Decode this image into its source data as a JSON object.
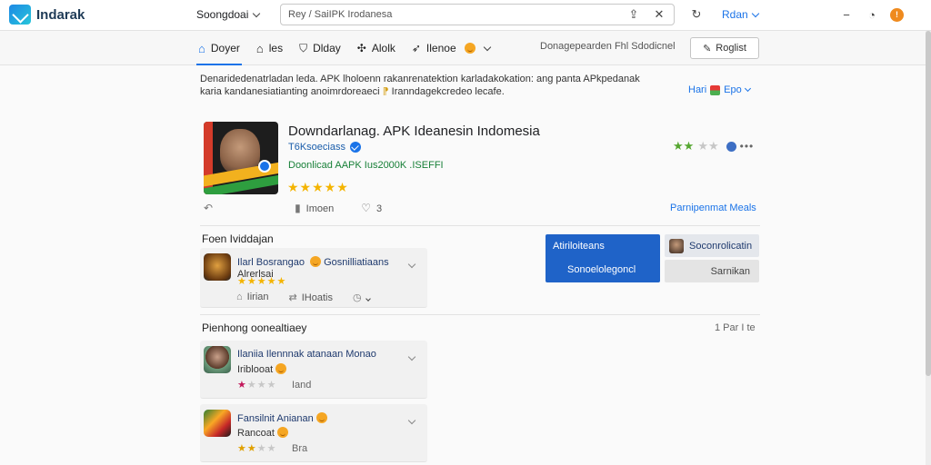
{
  "topbar": {
    "logo_text": "Indarak",
    "category_select": "Soongdoai",
    "search_placeholder": "Rey / SaiIPK  Irodanesa",
    "user_menu": "Rdan"
  },
  "nav": {
    "tabs": [
      {
        "label": "Doyer"
      },
      {
        "label": "les"
      },
      {
        "label": "Dlday"
      },
      {
        "label": "Alolk"
      },
      {
        "label": "Ilenoe"
      }
    ],
    "status_text": "Donagepearden  Fhl  Sdodicnel",
    "register_label": "Roglist"
  },
  "description": {
    "line1": "Denaridedenatrladan leda. APK lholoenn rakanrenatektion karladakokation:  ang  panta APkpedanak",
    "line2": "karia kandanesiatianting anoimrdoreaeci",
    "line2_end": "Iranndagekcredeo lecafe.",
    "lang_label": "Hari",
    "lang_value": "Epo"
  },
  "app": {
    "title": "Downdarlanag. APK Ideanesin Indomesia",
    "developer": "T6Ksoeciass",
    "download_text": "Doonlicad AAPK Ius2000K .ISEFFI",
    "stars": "★★★★★",
    "side_rating_on": "★★",
    "side_rating_off": "★★",
    "more": "•••",
    "action_share": "",
    "action_likes": "Imoen",
    "action_count": "3",
    "report_link": "Parnipenmat Meals"
  },
  "reviews_section": {
    "title": "Foen Ividdajan",
    "item": {
      "name": "Ilarl Bosrangao",
      "name_rest": "Gosnilliatiaans",
      "sub": "Alrerlsai",
      "stars": "★★★★★",
      "action1": "Iirian",
      "action2": "IHoatis"
    }
  },
  "promo": {
    "title": "Atiriloiteans",
    "subtitle": "Sonoelolegoncl",
    "btn1": "Soconrolicatin",
    "btn2": "Sarnikan"
  },
  "popular_section": {
    "title": "Pienhong oonealtiaey",
    "page_count": "1 Par I te",
    "items": [
      {
        "name": "Ilaniia Ilennnak atanaan Monao",
        "sub": "Iriblooat",
        "stars_on": "★",
        "stars_off": "★★★",
        "meta": "Iand"
      },
      {
        "name": "Fansilnit Anianan",
        "sub": "Rancoat",
        "stars_on": "★★",
        "stars_off": "★★",
        "meta": "Bra"
      }
    ]
  },
  "colors": {
    "accent": "#1a73e8",
    "promo_blue": "#1f63c8",
    "star_gold": "#f4b400",
    "download_green": "#188038"
  }
}
